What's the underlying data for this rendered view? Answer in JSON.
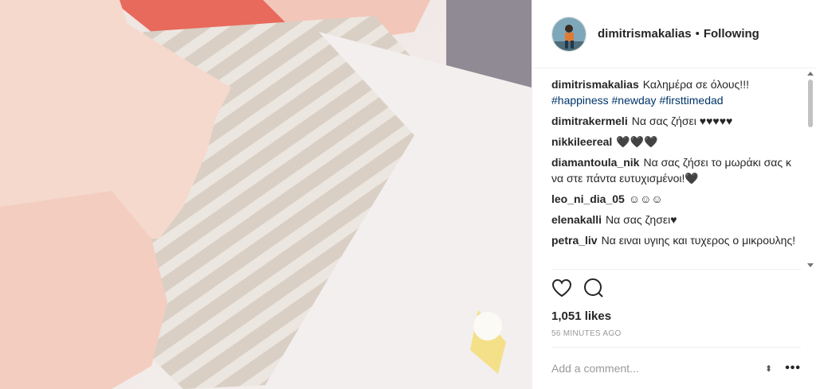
{
  "header": {
    "username": "dimitrismakalias",
    "separator": "•",
    "follow_label": "Following"
  },
  "caption": {
    "username": "dimitrismakalias",
    "text": "Καλημέρα σε όλους!!!",
    "hashtags": "#happiness #newday #firsttimedad"
  },
  "comments": [
    {
      "user": "dimitrakermeli",
      "text": "Να σας ζήσει ♥♥♥♥♥"
    },
    {
      "user": "nikkileereal",
      "text": "🖤🖤🖤"
    },
    {
      "user": "diamantoula_nik",
      "text": "Να σας ζήσει το μωράκι σας κ να στε πάντα ευτυχισμένοι!🖤"
    },
    {
      "user": "leo_ni_dia_05",
      "text": "☺☺☺"
    },
    {
      "user": "elenakalli",
      "text": "Να σας ζησει♥"
    },
    {
      "user": "petra_liv",
      "text": "Να ειναι υγιης και τυχερος ο μικρουλης!"
    }
  ],
  "actions": {
    "likes": "1,051 likes",
    "time": "56 MINUTES AGO"
  },
  "add_comment": {
    "placeholder": "Add a comment...",
    "more": "•••"
  }
}
